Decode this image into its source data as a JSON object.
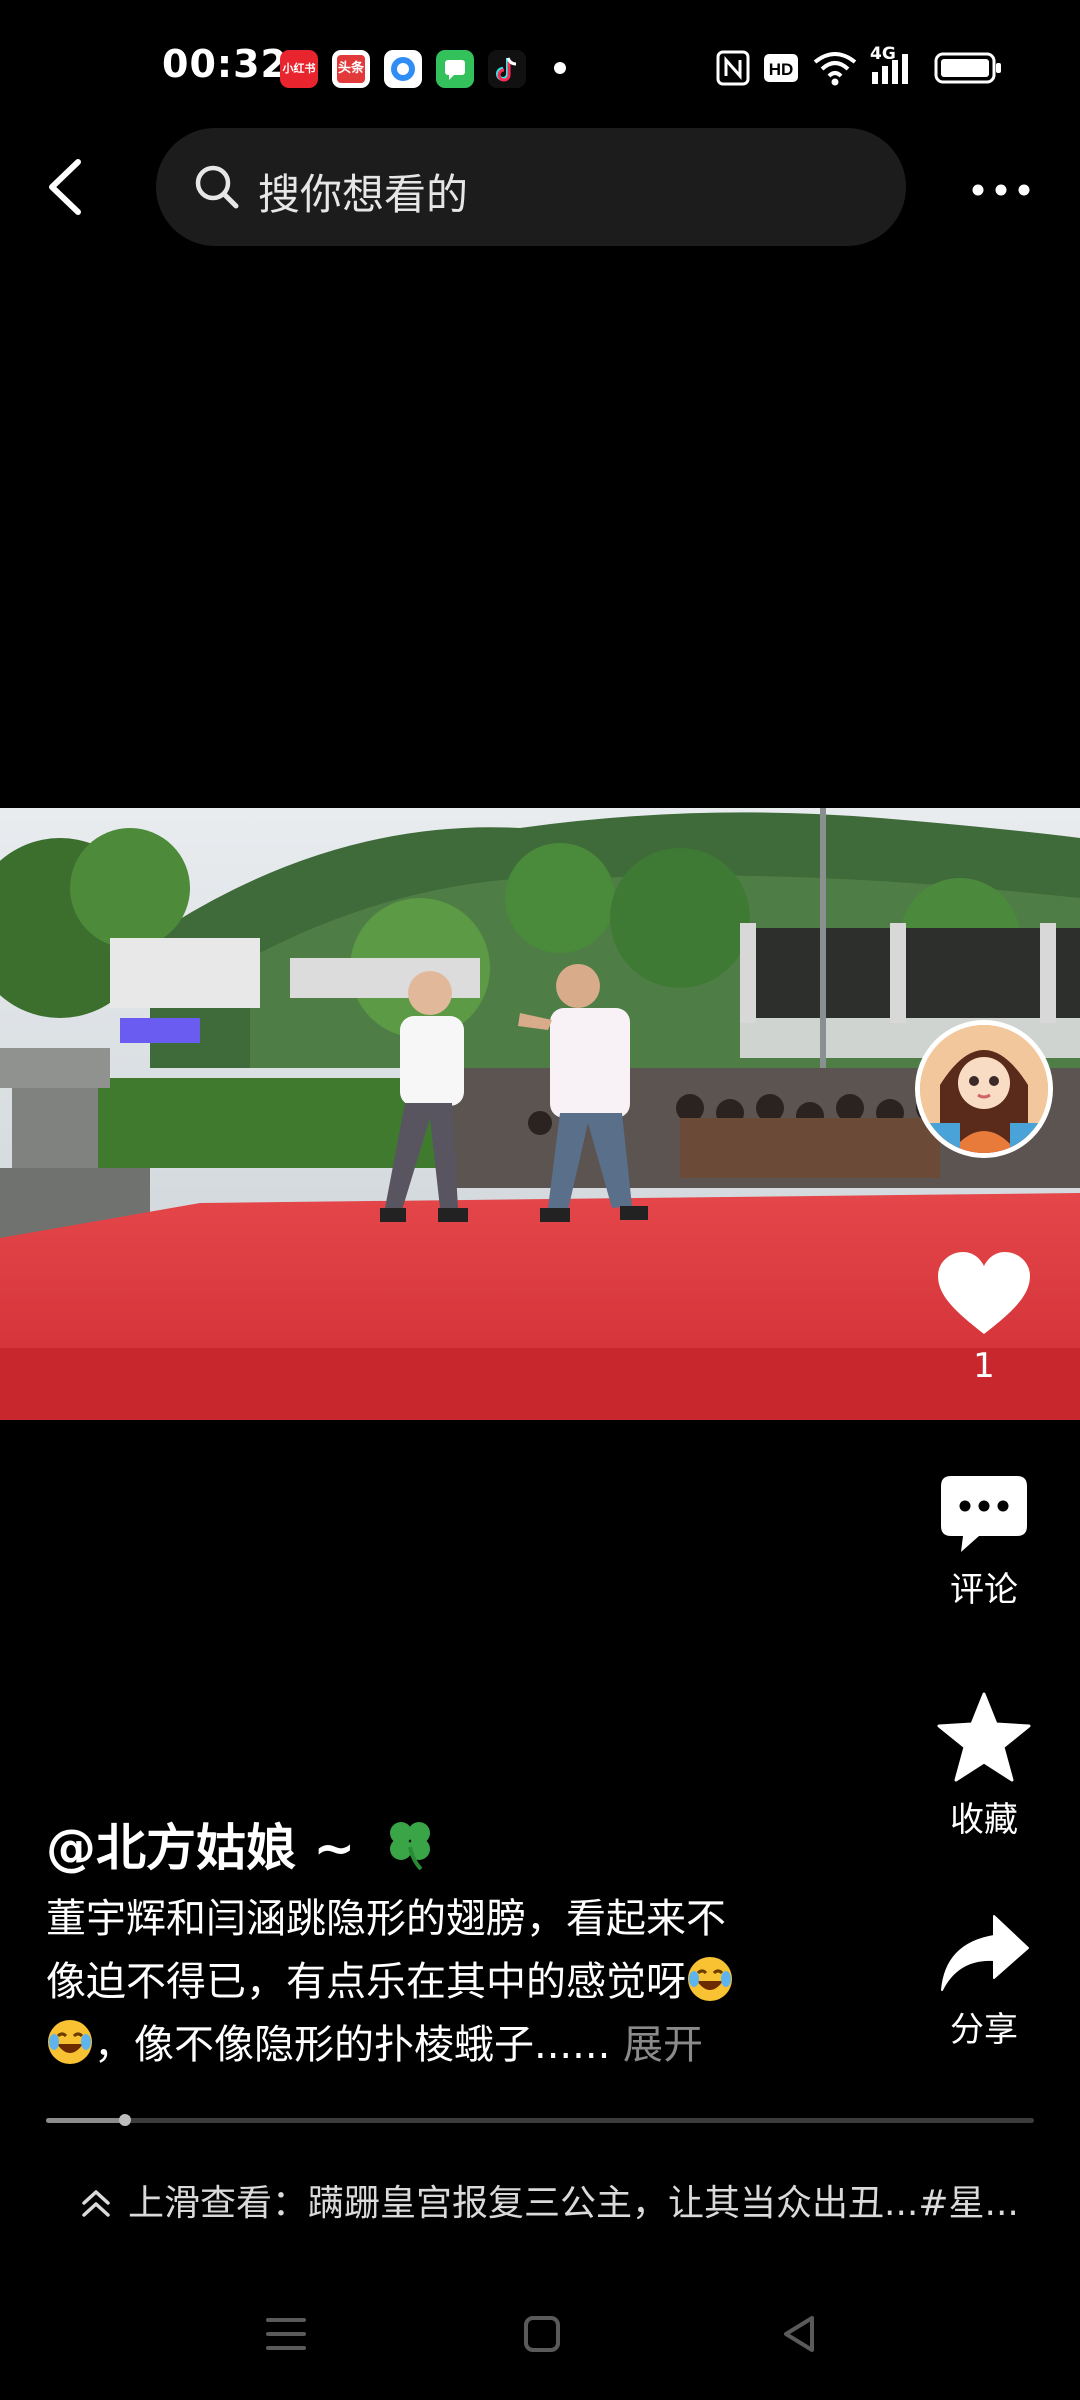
{
  "status_bar": {
    "time": "00:32",
    "notifications": [
      {
        "name": "xiaohongshu",
        "text": "小红书",
        "color": "#e8242e"
      },
      {
        "name": "toutiao",
        "text": "头条",
        "color": "#e23a3a"
      },
      {
        "name": "browser",
        "text": "",
        "color": "#2f8df5"
      },
      {
        "name": "messages",
        "text": "",
        "color": "#33c15c"
      },
      {
        "name": "douyin",
        "text": "",
        "color": "#111111"
      }
    ],
    "network": "4G"
  },
  "top_bar": {
    "search_placeholder": "搜你想看的"
  },
  "actions": {
    "like_count": "1",
    "comment_label": "评论",
    "favorite_label": "收藏",
    "share_label": "分享"
  },
  "post": {
    "author": "@北方姑娘 ~",
    "caption_line1": "董宇辉和闫涵跳隐形的翅膀，看起来不",
    "caption_line2": "像迫不得已，有点乐在其中的感觉呀",
    "caption_line3": "，像不像隐形的扑棱蛾子......",
    "expand_label": "展开"
  },
  "playback": {
    "progress": 0.08
  },
  "swipe_hint": {
    "text": "上滑查看：蹒跚皇宫报复三公主，让其当众出丑...#星..."
  },
  "colors": {
    "background": "#000000",
    "stage": "#e0393b",
    "heart": "#ffffff"
  }
}
